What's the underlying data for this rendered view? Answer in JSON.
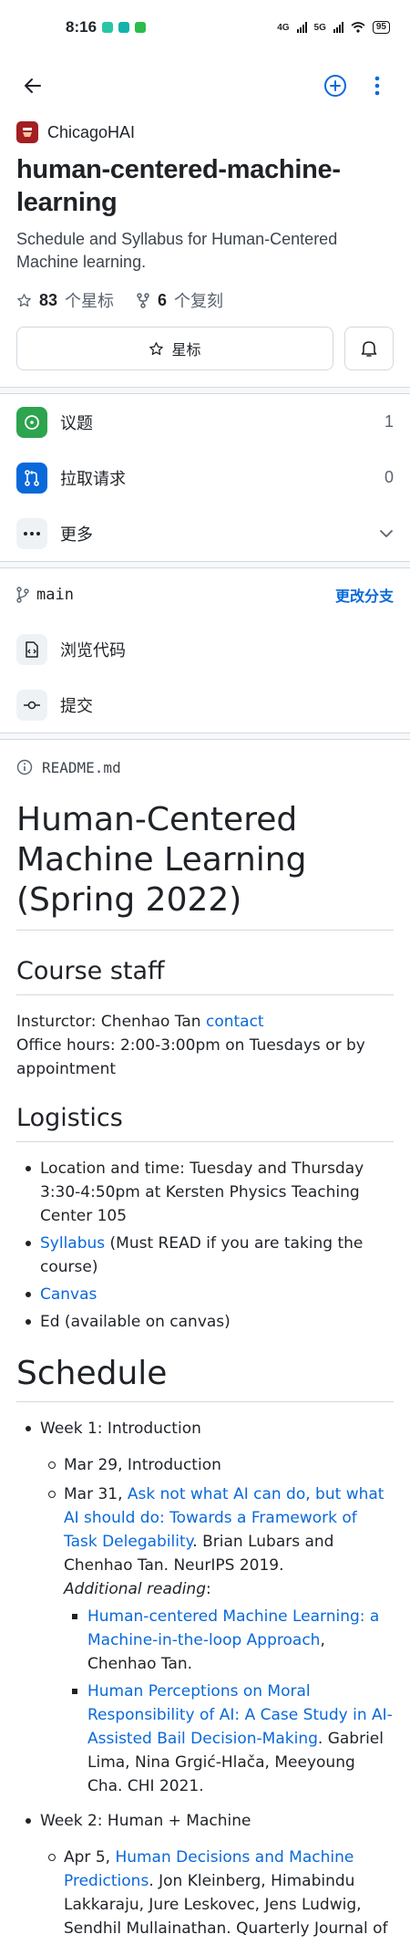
{
  "status_bar": {
    "time": "8:16",
    "net1": "4G",
    "net2": "5G",
    "battery": "95",
    "app_colors": [
      "#29c6a5",
      "#12b3ad",
      "#2dbb4c"
    ]
  },
  "owner": {
    "name": "ChicagoHAI"
  },
  "repo": {
    "name": "human-centered-machine-learning",
    "description": "Schedule and Syllabus for Human-Centered Machine learning."
  },
  "stats": {
    "stars_count": "83",
    "stars_label": "个星标",
    "forks_count": "6",
    "forks_label": "个复刻"
  },
  "buttons": {
    "star_label": "星标"
  },
  "nav_rows": {
    "issues": {
      "label": "议题",
      "count": "1",
      "color": "#2da44e"
    },
    "pulls": {
      "label": "拉取请求",
      "count": "0",
      "color": "#0969da"
    },
    "more": {
      "label": "更多"
    }
  },
  "branch": {
    "name": "main",
    "change_label": "更改分支"
  },
  "code_rows": {
    "browse": {
      "label": "浏览代码"
    },
    "commits": {
      "label": "提交"
    }
  },
  "readme": {
    "filename": "README.md",
    "title": "Human-Centered Machine Learning (Spring 2022)",
    "staff": {
      "heading": "Course staff",
      "instructor_prefix": "Insturctor: Chenhao Tan ",
      "instructor_link": "contact",
      "office_hours": "Office hours: 2:00-3:00pm on Tuesdays or by appointment"
    },
    "logistics": {
      "heading": "Logistics",
      "location": "Location and time: Tuesday and Thursday 3:30-4:50pm at Kersten Physics Teaching Center 105",
      "syllabus_link": "Syllabus",
      "syllabus_rest": " (Must READ if you are taking the course)",
      "canvas_link": "Canvas",
      "ed": "Ed (available on canvas)"
    },
    "schedule": {
      "heading": "Schedule",
      "week1": {
        "title": "Week 1: Introduction",
        "mar29": "Mar 29, Introduction",
        "mar31_prefix": "Mar 31, ",
        "mar31_link": "Ask not what AI can do, but what AI should do: Towards a Framework of Task Delegability",
        "mar31_rest": ". Brian Lubars and Chenhao Tan. NeurIPS 2019.",
        "additional_reading": "Additional reading",
        "additional_colon": ":",
        "r1_link": "Human-centered Machine Learning: a Machine-in-the-loop Approach",
        "r1_rest": ", Chenhao Tan.",
        "r2_link": "Human Perceptions on Moral Responsibility of AI: A Case Study in AI-Assisted Bail Decision-Making",
        "r2_rest": ". Gabriel Lima, Nina Grgić-Hlača, Meeyoung Cha. CHI 2021."
      },
      "week2": {
        "title": "Week 2: Human + Machine",
        "apr5_prefix": "Apr 5, ",
        "apr5_link": "Human Decisions and Machine Predictions",
        "apr5_rest": ". Jon Kleinberg, Himabindu Lakkaraju, Jure Leskovec, Jens Ludwig, Sendhil Mullainathan. Quarterly Journal of"
      }
    }
  }
}
